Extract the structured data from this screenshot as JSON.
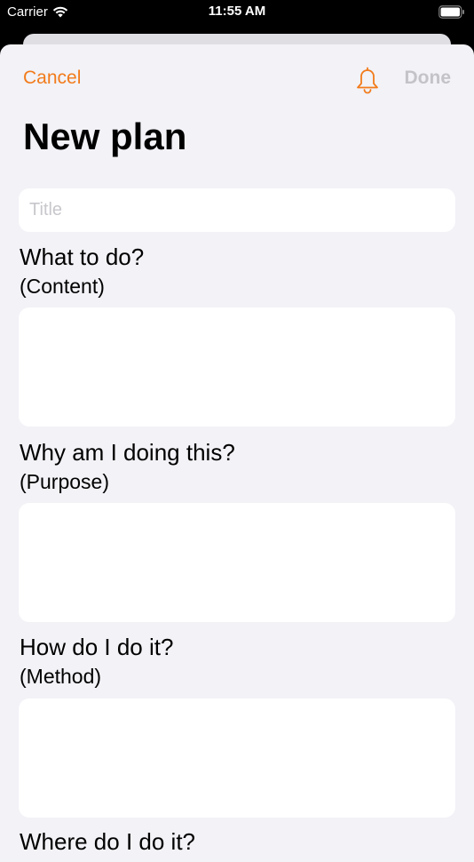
{
  "status_bar": {
    "carrier": "Carrier",
    "time": "11:55 AM"
  },
  "nav": {
    "cancel_label": "Cancel",
    "done_label": "Done",
    "accent_color": "#f27b1b",
    "disabled_color": "#c4c4c8",
    "bell_icon": "bell-icon"
  },
  "page": {
    "title": "New plan"
  },
  "title_field": {
    "placeholder": "Title",
    "value": ""
  },
  "fields": [
    {
      "label": "What to do?",
      "sub": "(Content)",
      "value": ""
    },
    {
      "label": "Why am I doing this?",
      "sub": "(Purpose)",
      "value": ""
    },
    {
      "label": "How do I do it?",
      "sub": "(Method)",
      "value": ""
    },
    {
      "label": "Where do I do it?",
      "sub": "",
      "value": ""
    }
  ]
}
